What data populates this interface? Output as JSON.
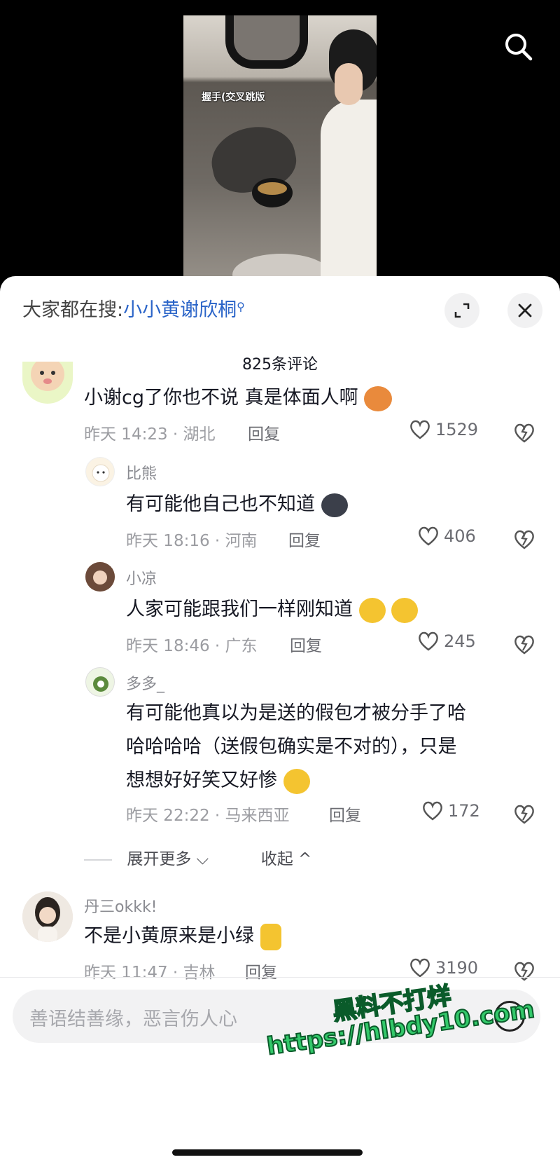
{
  "video": {
    "caption": "握手(交叉跳版"
  },
  "top_bar": {
    "search_icon": "search-icon"
  },
  "sheet": {
    "search_prefix": "大家都在搜:",
    "search_keyword": "小小黄谢欣桐",
    "comment_count": "825条评论",
    "expand_icon": "expand-icon",
    "close_icon": "close-icon"
  },
  "comments": [
    {
      "username": "",
      "text": "小谢cg了你也不说 真是体面人啊",
      "emoji": "bear-face-emoji",
      "meta": "昨天 14:23 · 湖北",
      "reply_label": "回复",
      "likes": "1529"
    },
    {
      "username": "比熊",
      "text": "有可能他自己也不知道",
      "emoji": "dark-blob-emoji",
      "meta": "昨天 18:16 · 河南",
      "reply_label": "回复",
      "likes": "406"
    },
    {
      "username": "小凉",
      "text": "人家可能跟我们一样刚知道",
      "emoji": "rolling-laugh-emoji",
      "meta": "昨天 18:46 · 广东",
      "reply_label": "回复",
      "likes": "245"
    },
    {
      "username": "多多_",
      "text_lines": [
        "有可能他真以为是送的假包才被分手了哈",
        "哈哈哈哈（送假包确实是不对的），只是",
        "想想好好笑又好惨"
      ],
      "emoji": "cry-laugh-emoji",
      "meta": "昨天 22:22 · 马来西亚",
      "reply_label": "回复",
      "likes": "172"
    },
    {
      "username": "丹三okkk!",
      "text": "不是小黄原来是小绿",
      "emoji": "finger-heart-emoji",
      "meta": "昨天 11:47 · 吉林",
      "reply_label": "回复",
      "likes": "3190"
    }
  ],
  "replies_controls": {
    "expand_more": "展开更多",
    "collapse": "收起"
  },
  "input": {
    "placeholder": "善语结善缘，恶言伤人心"
  },
  "watermark": {
    "line1": "黑料不打烊",
    "line2": "https://hlbdy10.com"
  }
}
